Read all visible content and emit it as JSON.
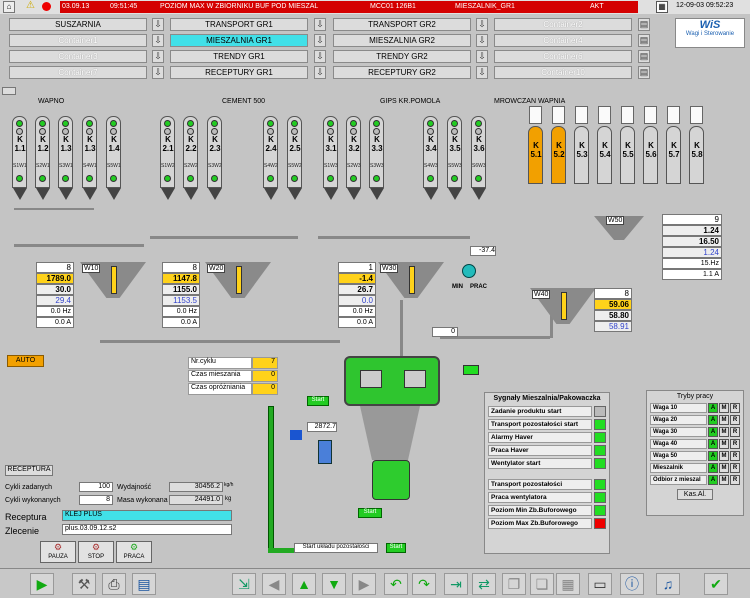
{
  "alarm": {
    "date": "03.09.13",
    "time": "09:51:45",
    "message": "POZIOM MAX W ZBIORNIKU BUF POD MIESZAL",
    "code": "MCC01 126B1",
    "source": "MIESZALNIK_GR1",
    "status": "AKT",
    "clock": "12-09-03 09:52:23"
  },
  "tabs": [
    {
      "label": "SUSZARNIA",
      "state": "on"
    },
    {
      "label": "Container1",
      "state": "off"
    },
    {
      "label": "Container3",
      "state": "off"
    },
    {
      "label": "Container7",
      "state": "off"
    },
    {
      "label": "TRANSPORT GR1",
      "state": "on"
    },
    {
      "label": "MIESZALNIA GR1",
      "state": "sel"
    },
    {
      "label": "TRENDY GR1",
      "state": "on"
    },
    {
      "label": "RECEPTURY GR1",
      "state": "on"
    },
    {
      "label": "TRANSPORT GR2",
      "state": "on"
    },
    {
      "label": "MIESZALNIA GR2",
      "state": "on"
    },
    {
      "label": "TRENDY GR2",
      "state": "on"
    },
    {
      "label": "RECEPTURY GR2",
      "state": "on"
    },
    {
      "label": "Container2",
      "state": "off"
    },
    {
      "label": "Container4",
      "state": "off"
    },
    {
      "label": "Container6",
      "state": "off"
    },
    {
      "label": "Container10",
      "state": "off"
    }
  ],
  "logo": {
    "name": "WiS",
    "sub": "Wagi i Sterowanie"
  },
  "groups": {
    "wapno": "WAPNO",
    "cement": "CEMENT 500",
    "gips": "GIPS KR.POMOLA",
    "mrowczan": "MROWCZAN WAPNIA"
  },
  "silos": [
    {
      "k": "1.1",
      "id": "S1W1"
    },
    {
      "k": "1.2",
      "id": "S2W1"
    },
    {
      "k": "1.3",
      "id": "S3W1"
    },
    {
      "k": "1.3",
      "id": "S4W1"
    },
    {
      "k": "1.4",
      "id": "S5W1"
    },
    {
      "k": "2.1",
      "id": "S1W2"
    },
    {
      "k": "2.2",
      "id": "S2W2"
    },
    {
      "k": "2.3",
      "id": "S3W2"
    },
    {
      "k": "2.4",
      "id": "S4W2"
    },
    {
      "k": "2.5",
      "id": "S5W2"
    },
    {
      "k": "3.1",
      "id": "S1W3"
    },
    {
      "k": "3.2",
      "id": "S2W3"
    },
    {
      "k": "3.3",
      "id": "S3W3"
    },
    {
      "k": "3.4",
      "id": "S4W3"
    },
    {
      "k": "3.5",
      "id": "S5W3"
    },
    {
      "k": "3.6",
      "id": "S6W3"
    }
  ],
  "kbig": [
    "5.1",
    "5.2",
    "5.3",
    "5.4",
    "5.5",
    "5.6",
    "5.7",
    "5.8"
  ],
  "w10": {
    "name": "W10",
    "a": "8",
    "b": "1789.0",
    "c": "30.0",
    "d": "29.4",
    "hz": "0.0",
    "hzu": "Hz",
    "amp": "0.0",
    "ampu": "A"
  },
  "w20": {
    "name": "W20",
    "a": "8",
    "b": "1147.8",
    "c": "1155.0",
    "d": "1153.5",
    "hz": "0.0",
    "hzu": "Hz",
    "amp": "0.0",
    "ampu": "A"
  },
  "w30": {
    "name": "W30",
    "a": "1",
    "b": "-1.4",
    "c": "26.7",
    "d": "0.0",
    "hz": "0.0",
    "hzu": "Hz",
    "amp": "0.0",
    "ampu": "A"
  },
  "w40": {
    "name": "W40",
    "a": "8",
    "b": "59.06",
    "c": "58.80",
    "d": "58.91"
  },
  "w50": {
    "name": "W50",
    "a": "9",
    "b": "1.24",
    "c": "16.50",
    "d": "1.24",
    "hz": "15.Hz",
    "amp": "1.1",
    "ampu": "A"
  },
  "press": {
    "val": "-37.4",
    "min": "MIN",
    "prac": "PRAC"
  },
  "center_val": "0",
  "cycle": {
    "nr_label": "Nr.cyklu",
    "nr": "7",
    "mix_label": "Czas mieszania",
    "mix": "0",
    "empty_label": "Czas opróżniania",
    "empty": "0"
  },
  "mixer": {
    "start": "Start",
    "val2": "2872.7",
    "start2": "Start",
    "start_ukl": "Start układu pozostałości"
  },
  "auto": "AUTO",
  "signals": {
    "title": "Sygnały Mieszalnia/Pakowaczka",
    "items": [
      {
        "label": "Zadanie produktu start",
        "c": "gr"
      },
      {
        "label": "Transport pozostałości start",
        "c": "g"
      },
      {
        "label": "Alarmy Haver",
        "c": "g"
      },
      {
        "label": "Praca Haver",
        "c": "g"
      },
      {
        "label": "Wentylator start",
        "c": "g"
      },
      {
        "label": "Transport pozostałości",
        "c": "g"
      },
      {
        "label": "Praca wentylatora",
        "c": "g"
      },
      {
        "label": "Poziom Min Zb.Buforowego",
        "c": "g"
      },
      {
        "label": "Poziom Max Zb.Buforowego",
        "c": "r"
      }
    ]
  },
  "modes": {
    "title": "Tryby pracy",
    "rows": [
      "Waga 10",
      "Waga 20",
      "Waga 30",
      "Waga 40",
      "Waga 50",
      "Mieszalnik",
      "Odbior z mieszal"
    ],
    "btns": [
      "A",
      "M",
      "R"
    ],
    "kas": "Kas.Al."
  },
  "receptura": {
    "title": "RECEPTURA",
    "zad_label": "Cykli zadanych",
    "zad": "100",
    "wyk_label": "Cykli wykonanych",
    "wyk": "8",
    "wyd_label": "Wydajność",
    "wyd": "30456.2",
    "wyd_u": "kg/h",
    "masa_label": "Masa wykonana",
    "masa": "24491.0",
    "masa_u": "kg",
    "rec_label": "Receptura",
    "rec": "KLEJ PLUS",
    "zlec_label": "Zlecenie",
    "zlec": "plus.03.09.12.s2"
  },
  "bottombtns": {
    "pauza": "PAUZA",
    "stop": "STOP",
    "praca": "PRACA"
  }
}
